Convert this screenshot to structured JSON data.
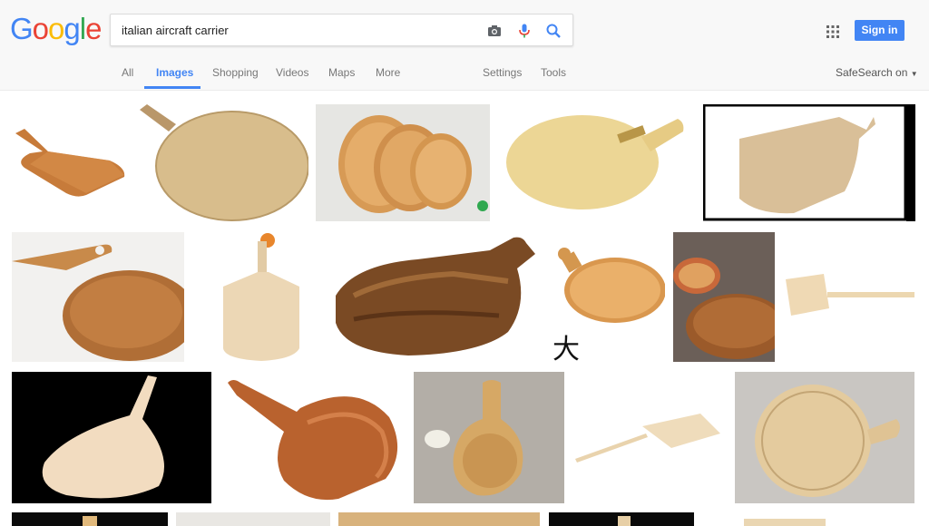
{
  "logo": [
    "G",
    "o",
    "o",
    "g",
    "l",
    "e"
  ],
  "logo_colors": [
    "#4285f4",
    "#ea4335",
    "#fbbc05",
    "#4285f4",
    "#34a853",
    "#ea4335"
  ],
  "search": {
    "query": "italian aircraft carrier"
  },
  "header": {
    "signin_label": "Sign in"
  },
  "tabs": [
    {
      "label": "All"
    },
    {
      "label": "Images"
    },
    {
      "label": "Shopping"
    },
    {
      "label": "Videos"
    },
    {
      "label": "Maps"
    },
    {
      "label": "More"
    },
    {
      "label": "Settings"
    },
    {
      "label": "Tools"
    }
  ],
  "safesearch_label": "SafeSearch on",
  "results": {
    "caption_char": "大"
  },
  "colors": {
    "accent": "#4285f4",
    "wood_light": "#e9cf98",
    "wood_mid": "#d4a265",
    "wood_dark": "#8a5530"
  }
}
